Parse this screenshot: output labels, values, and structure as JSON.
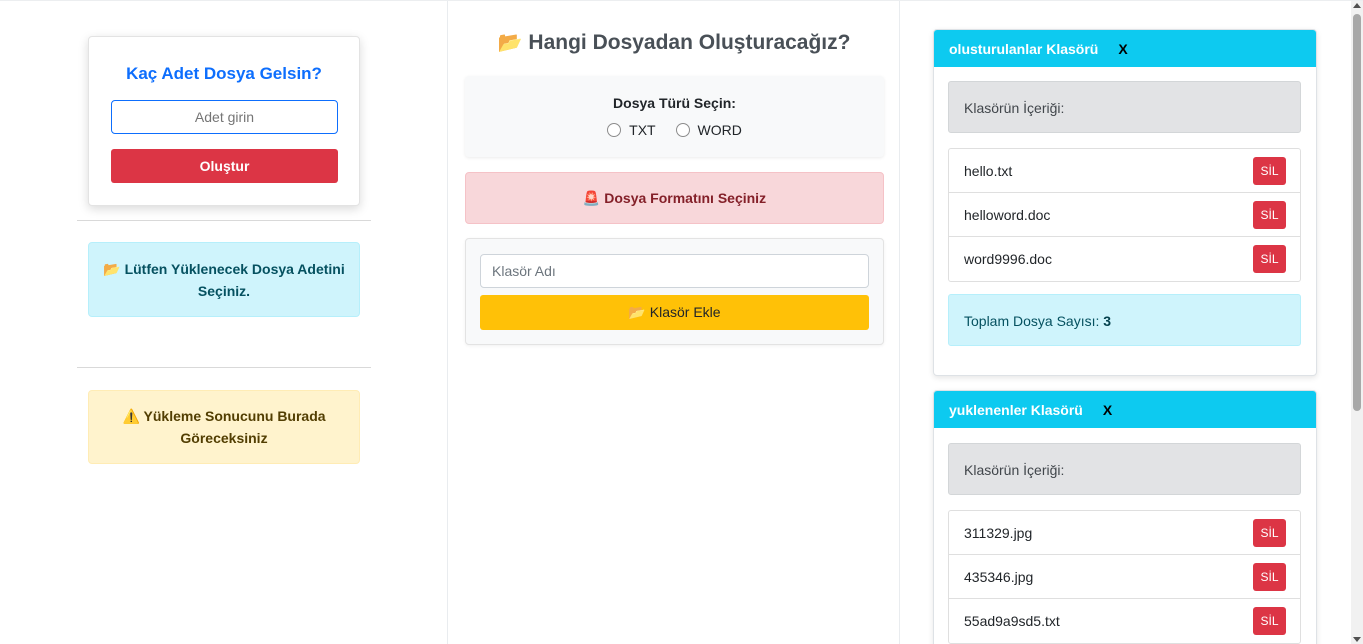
{
  "left": {
    "count_title": "Kaç Adet Dosya Gelsin?",
    "count_placeholder": "Adet girin",
    "create_button": "Oluştur",
    "info_icon": "📂",
    "info_text": "Lütfen Yüklenecek Dosya Adetini Seçiniz.",
    "warn_icon": "⚠️",
    "warn_text": "Yükleme Sonucunu Burada Göreceksiniz"
  },
  "middle": {
    "title_icon": "📂",
    "title": "Hangi Dosyadan Oluşturacağız?",
    "type_label": "Dosya Türü Seçin:",
    "radio_txt": "TXT",
    "radio_word": "WORD",
    "format_icon": "🚨",
    "format_alert": "Dosya Formatını Seçiniz",
    "folder_placeholder": "Klasör Adı",
    "add_icon": "📂",
    "add_button": "Klasör Ekle"
  },
  "folders": [
    {
      "name": "olusturulanlar Klasörü",
      "close": "X",
      "contents_label": "Klasörün İçeriği:",
      "files": [
        "hello.txt",
        "helloword.doc",
        "word9996.doc"
      ],
      "total_label": "Toplam Dosya Sayısı:",
      "total": "3"
    },
    {
      "name": "yuklenenler Klasörü",
      "close": "X",
      "contents_label": "Klasörün İçeriği:",
      "files": [
        "311329.jpg",
        "435346.jpg",
        "55ad9a9sd5.txt"
      ]
    }
  ],
  "delete_label": "SİL",
  "colors": {
    "primary": "#0d6efd",
    "danger": "#dc3545",
    "warning": "#ffc107",
    "info": "#0dcaf0"
  }
}
